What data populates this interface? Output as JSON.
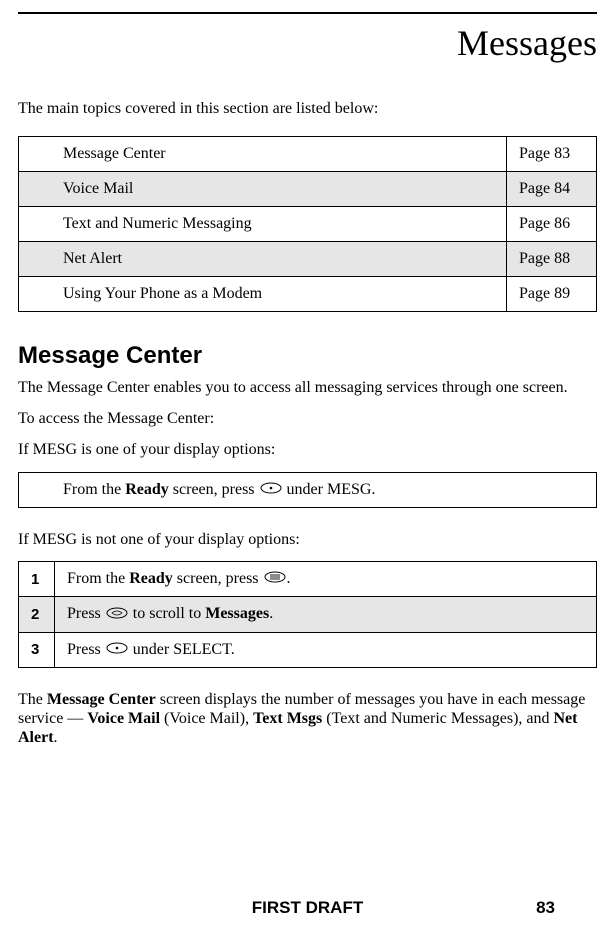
{
  "chapter": {
    "title": "Messages"
  },
  "intro": "The main topics covered in this section are listed below:",
  "topics": [
    {
      "name": "Message Center",
      "page": "Page 83",
      "shaded": false
    },
    {
      "name": "Voice Mail",
      "page": "Page 84",
      "shaded": true
    },
    {
      "name": "Text and Numeric Messaging",
      "page": "Page 86",
      "shaded": false
    },
    {
      "name": "Net Alert",
      "page": "Page 88",
      "shaded": true
    },
    {
      "name": "Using Your Phone as a Modem",
      "page": "Page 89",
      "shaded": false
    }
  ],
  "section1": {
    "title": "Message Center",
    "p1": "The Message Center enables you to access all messaging services through one screen.",
    "p2": "To access the Message Center:",
    "p3": "If MESG is one of your display options:",
    "inst1_pre": "From the ",
    "inst1_b": "Ready",
    "inst1_mid": " screen, press ",
    "inst1_post": " under MESG.",
    "p4": "If MESG is not one of your display options:",
    "step1_pre": "From the ",
    "step1_b": "Ready",
    "step1_mid": " screen, press ",
    "step1_post": ".",
    "step2_pre": "Press ",
    "step2_mid": " to scroll to ",
    "step2_b": "Messages",
    "step2_post": ".",
    "step3_pre": "Press ",
    "step3_post": " under SELECT.",
    "nums": {
      "n1": "1",
      "n2": "2",
      "n3": "3"
    },
    "final_t1": "The ",
    "final_b1": "Message Center",
    "final_t2": " screen displays the number of messages you have in each message service — ",
    "final_b2": "Voice Mail",
    "final_t3": " (Voice Mail), ",
    "final_b3": "Text Msgs",
    "final_t4": " (Text and Numeric Messages), and ",
    "final_b4": "Net Alert",
    "final_t5": "."
  },
  "footer": {
    "label": "FIRST DRAFT",
    "page": "83"
  }
}
